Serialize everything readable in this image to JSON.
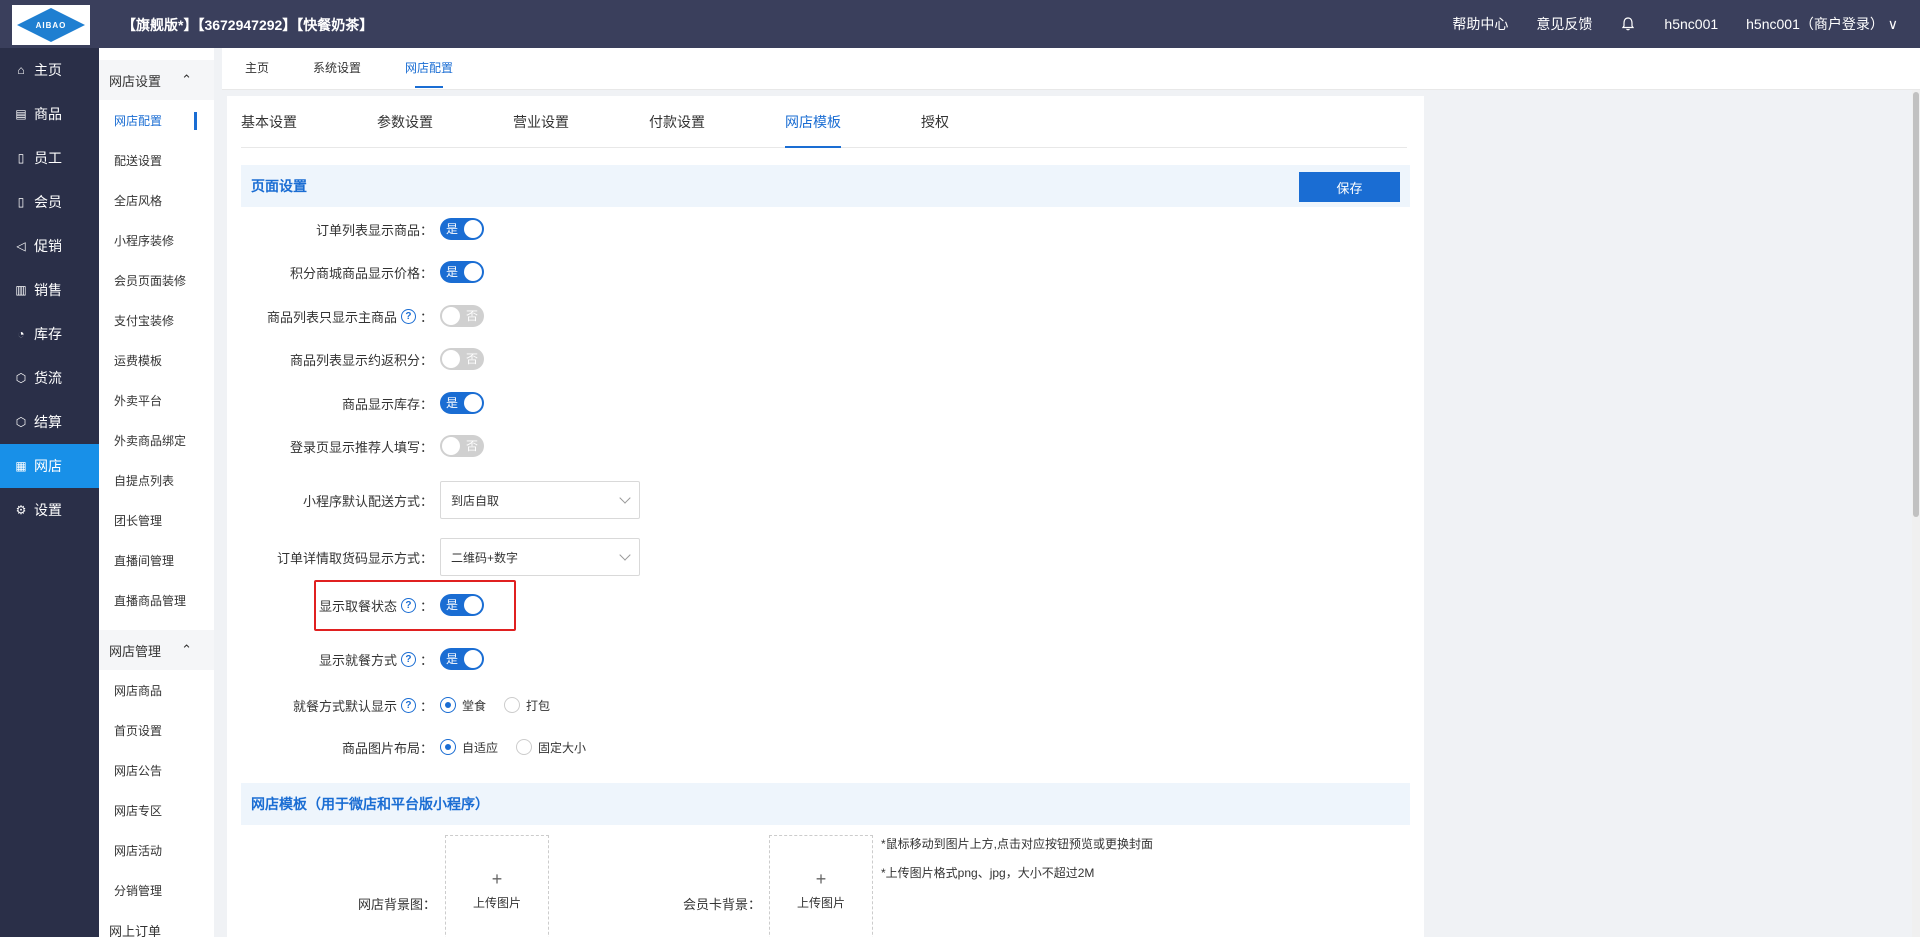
{
  "topbar": {
    "logo_text": "AIBAO",
    "shop_info": "【旗舰版*】【3672947292】【快餐奶茶】",
    "help": "帮助中心",
    "feedback": "意见反馈",
    "user": "h5nc001",
    "login_user": "h5nc001（商户登录）",
    "bell_icon": "bell-icon"
  },
  "leftnav": [
    {
      "label": "主页",
      "icon": "⌂"
    },
    {
      "label": "商品",
      "icon": "▤"
    },
    {
      "label": "员工",
      "icon": "▯"
    },
    {
      "label": "会员",
      "icon": "▯"
    },
    {
      "label": "促销",
      "icon": "◁"
    },
    {
      "label": "销售",
      "icon": "▥"
    },
    {
      "label": "库存",
      "icon": "◔"
    },
    {
      "label": "货流",
      "icon": "⬡"
    },
    {
      "label": "结算",
      "icon": "⬡"
    },
    {
      "label": "网店",
      "icon": "▦"
    },
    {
      "label": "设置",
      "icon": "⚙"
    }
  ],
  "subnav": {
    "group1": "网店设置",
    "group1_items": [
      "网店配置",
      "配送设置",
      "全店风格",
      "小程序装修",
      "会员页面装修",
      "支付宝装修",
      "运费模板",
      "外卖平台",
      "外卖商品绑定",
      "自提点列表",
      "团长管理",
      "直播间管理",
      "直播商品管理"
    ],
    "group2": "网店管理",
    "group2_items": [
      "网店商品",
      "首页设置",
      "网店公告",
      "网店专区",
      "网店活动",
      "分销管理"
    ],
    "group3": "网上订单"
  },
  "crumbs": [
    "主页",
    "系统设置",
    "网店配置"
  ],
  "tabs": [
    "基本设置",
    "参数设置",
    "营业设置",
    "付款设置",
    "网店模板",
    "授权"
  ],
  "section1": {
    "title": "页面设置",
    "save": "保存"
  },
  "settings": {
    "order_list_show_goods": {
      "label": "订单列表显示商品：",
      "value": "是"
    },
    "points_mall_show_price": {
      "label": "积分商城商品显示价格：",
      "value": "是"
    },
    "goods_list_main_only": {
      "label": "商品列表只显示主商品",
      "colon": "：",
      "value": "否"
    },
    "goods_list_show_points": {
      "label": "商品列表显示约返积分：",
      "value": "否"
    },
    "goods_show_stock": {
      "label": "商品显示库存：",
      "value": "是"
    },
    "login_show_referrer": {
      "label": "登录页显示推荐人填写：",
      "value": "否"
    },
    "mini_default_delivery": {
      "label": "小程序默认配送方式：",
      "value": "到店自取"
    },
    "pickup_code_display": {
      "label": "订单详情取货码显示方式：",
      "value": "二维码+数字"
    },
    "show_meal_status": {
      "label": "显示取餐状态",
      "colon": "：",
      "value": "是"
    },
    "show_dining_mode": {
      "label": "显示就餐方式",
      "colon": "：",
      "value": "是"
    },
    "dining_default": {
      "label": "就餐方式默认显示",
      "colon": "：",
      "opt1": "堂食",
      "opt2": "打包"
    },
    "image_layout": {
      "label": "商品图片布局：",
      "opt1": "自适应",
      "opt2": "固定大小"
    }
  },
  "section2": {
    "title": "网店模板（用于微店和平台版小程序）"
  },
  "template": {
    "bg_label": "网店背景图：",
    "card_label": "会员卡背景：",
    "upload_text": "上传图片",
    "plus": "+",
    "note1": "*鼠标移动到图片上方,点击对应按钮预览或更换封面",
    "note2": "*上传图片格式png、jpg，大小不超过2M"
  },
  "colors": {
    "accent": "#1a6dd3",
    "topbar": "#3a3f5c",
    "leftnav": "#2a2f48",
    "nav_active": "#1890e8",
    "highlight": "#e02020"
  }
}
